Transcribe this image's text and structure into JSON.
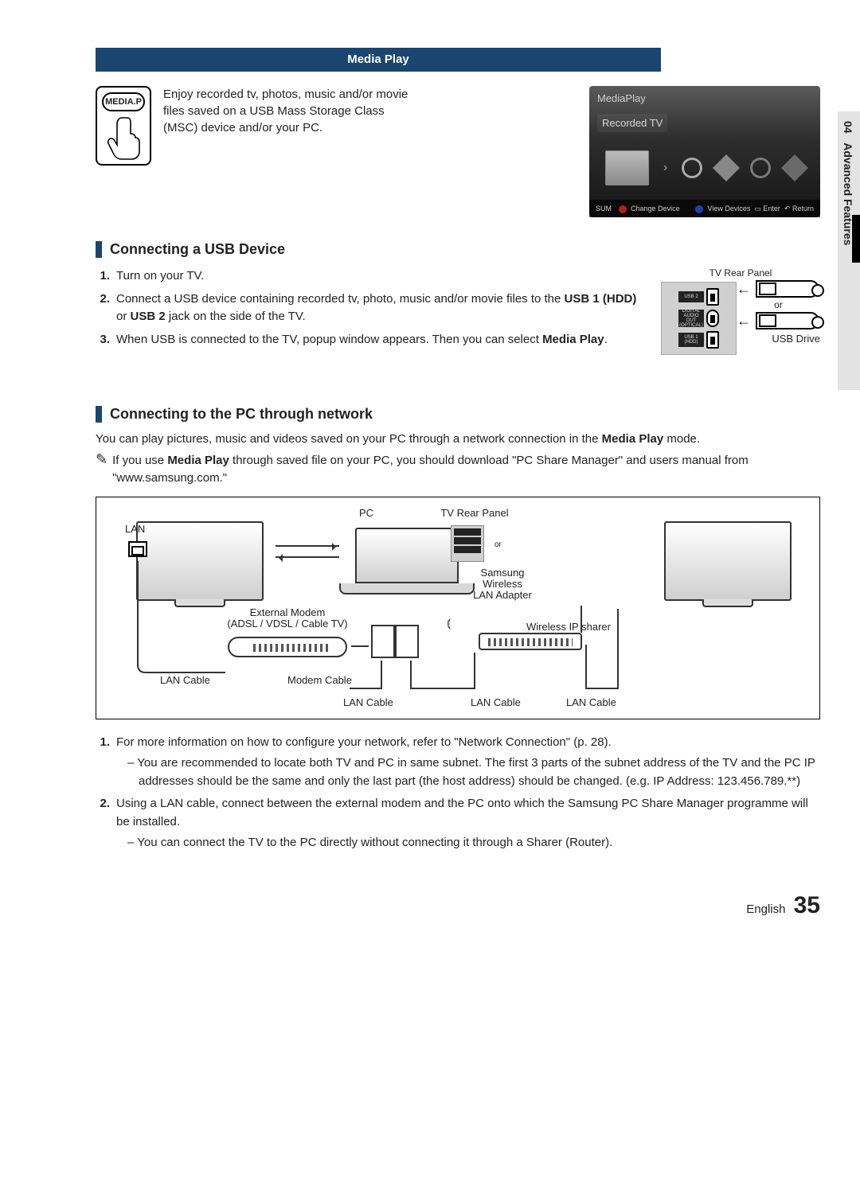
{
  "side": {
    "section_number": "04",
    "section_title": "Advanced Features"
  },
  "banner": {
    "title": "Media Play"
  },
  "remote": {
    "button_label": "MEDIA.P"
  },
  "intro": "Enjoy recorded tv, photos, music and/or movie files saved on a USB Mass Storage Class (MSC) device and/or your PC.",
  "tv_preview": {
    "title": "MediaPlay",
    "selection": "Recorded TV",
    "footer_left_1": "SUM",
    "footer_left_2": "Change Device",
    "footer_right_1": "View Devices",
    "footer_right_2": "Enter",
    "footer_right_3": "Return"
  },
  "section_usb": {
    "heading": "Connecting a USB Device",
    "steps": [
      {
        "n": "1.",
        "text": "Turn on your TV."
      },
      {
        "n": "2.",
        "text_before": "Connect a USB device containing recorded tv, photo, music and/or movie files to the ",
        "bold1": "USB 1 (HDD)",
        "mid": " or ",
        "bold2": "USB 2",
        "text_after": " jack on the side of the TV."
      },
      {
        "n": "3.",
        "text_before": "When USB is connected to the TV, popup window appears. Then you can select ",
        "bold1": "Media Play",
        "text_after": "."
      }
    ],
    "diagram": {
      "panel_title": "TV Rear Panel",
      "port1": "USB 2",
      "port2_line1": "DIGITAL",
      "port2_line2": "AUDIO OUT",
      "port2_line3": "(OPTICAL)",
      "port3_line1": "USB 1",
      "port3_line2": "(HDD)",
      "or": "or",
      "drive": "USB Drive"
    }
  },
  "section_pc": {
    "heading": "Connecting to the PC through network",
    "intro_before": "You can play pictures, music and videos saved on your PC through a network connection in the ",
    "intro_bold": "Media Play",
    "intro_after": " mode.",
    "note_before": "If you use ",
    "note_bold": "Media Play",
    "note_after": " through saved file on your PC, you should download \"PC Share Manager\" and users manual from \"www.samsung.com.\"",
    "diagram": {
      "pc": "PC",
      "rear": "TV Rear Panel",
      "lan": "LAN",
      "ext_modem_1": "External Modem",
      "ext_modem_2": "(ADSL / VDSL / Cable TV)",
      "adapter_1": "Samsung",
      "adapter_2": "Wireless",
      "adapter_3": "LAN Adapter",
      "sharer": "Wireless IP sharer",
      "lan_cable": "LAN Cable",
      "modem_cable": "Modem Cable",
      "or": "or"
    },
    "steps": [
      {
        "n": "1.",
        "text": "For more information on how to configure your network, refer to \"Network Connection\" (p. 28).",
        "sub": [
          "You are recommended to locate both TV and PC in same subnet. The first 3 parts of the subnet address of the TV and the PC IP addresses should be the same and only the last part (the host address) should be changed. (e.g. IP Address: 123.456.789.**)"
        ]
      },
      {
        "n": "2.",
        "text": "Using a LAN cable, connect between the external modem and the PC onto which the Samsung PC Share Manager programme will be installed.",
        "sub": [
          "You can connect the TV to the PC directly without connecting it through a Sharer (Router)."
        ]
      }
    ]
  },
  "footer": {
    "lang": "English",
    "page": "35"
  }
}
